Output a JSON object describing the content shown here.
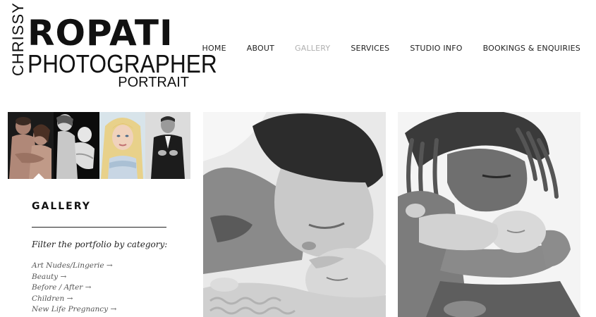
{
  "logo": {
    "vertical": "CHRISSY",
    "main": "ROPATI",
    "sub": "PHOTOGRAPHER",
    "tag": "PORTRAIT"
  },
  "nav": {
    "items": [
      {
        "label": "HOME",
        "active": false
      },
      {
        "label": "ABOUT",
        "active": false
      },
      {
        "label": "GALLERY",
        "active": true
      },
      {
        "label": "SERVICES",
        "active": false
      },
      {
        "label": "STUDIO INFO",
        "active": false
      },
      {
        "label": "BOOKINGS & ENQUIRIES",
        "active": false
      }
    ],
    "active_color": "#b0b0b0"
  },
  "sidebar": {
    "title": "GALLERY",
    "filter_label": "Filter the portfolio by category:",
    "categories": [
      "Art Nudes/Lingerie →",
      "Beauty →",
      "Before / After →",
      "Children →",
      "New Life Pregnancy →"
    ]
  }
}
